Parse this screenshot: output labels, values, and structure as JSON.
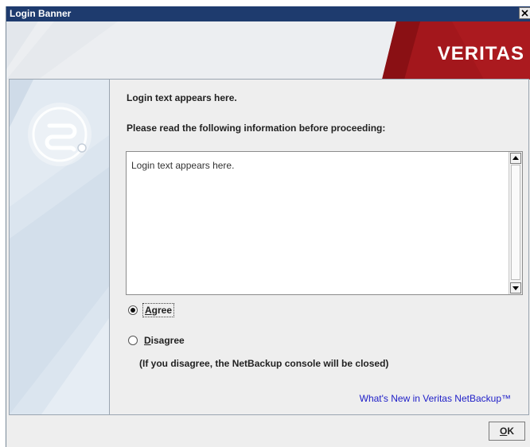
{
  "window": {
    "title": "Login Banner",
    "close_icon": "close-x-icon"
  },
  "banner": {
    "logo_text": "VERITAS",
    "brand_color": "#9e1b1f"
  },
  "sidepanel": {
    "icon": "netbackup-swirl-icon"
  },
  "main": {
    "intro_text": "Login text appears here.",
    "instruction_text": "Please read the following information before proceeding:",
    "textbox_content": "Login text appears here.",
    "agree": {
      "label_mnemonic": "A",
      "label_rest": "gree",
      "selected": true
    },
    "disagree": {
      "label_mnemonic": "D",
      "label_rest": "isagree",
      "selected": false
    },
    "note": "(If you disagree, the NetBackup console will be closed)",
    "link_text": "What's New in Veritas NetBackup™"
  },
  "footer": {
    "ok_mnemonic": "O",
    "ok_rest": "K"
  }
}
